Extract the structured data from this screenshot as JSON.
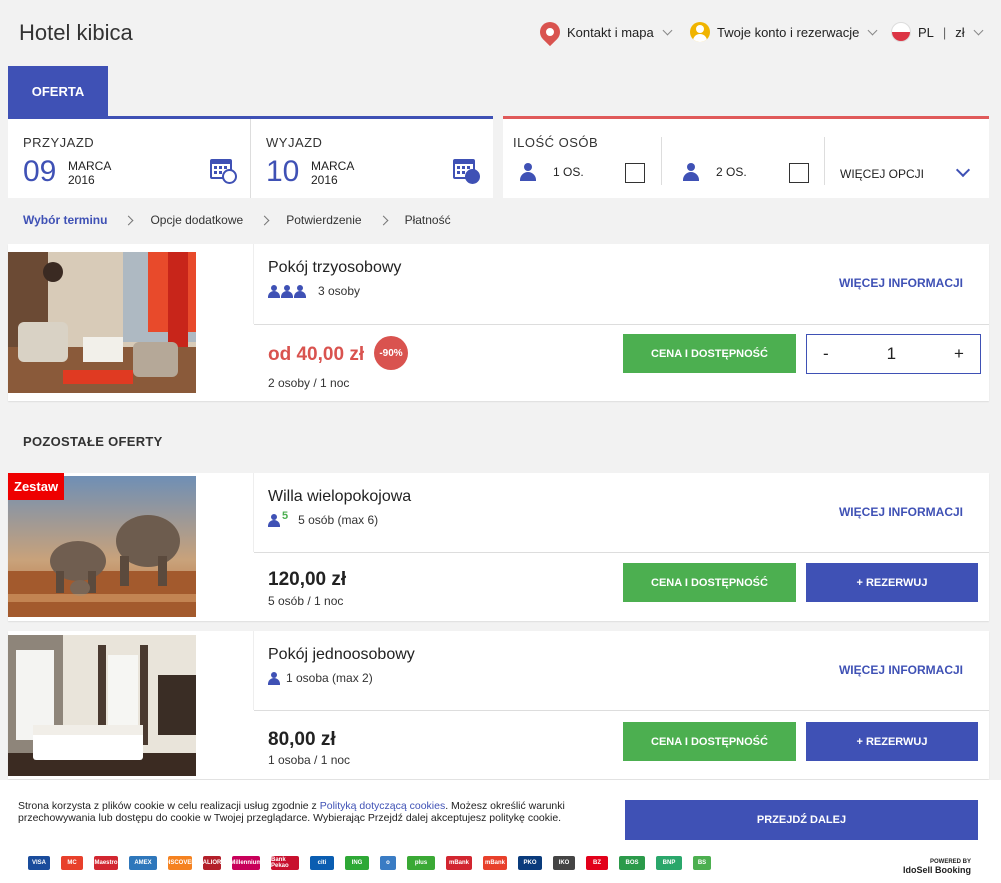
{
  "header": {
    "brand": "Hotel kibica",
    "contact": "Kontakt i mapa",
    "account": "Twoje konto i rezerwacje",
    "lang": "PL",
    "currency": "zł"
  },
  "tabs": {
    "offer": "OFERTA"
  },
  "search": {
    "checkin": {
      "label": "PRZYJAZD",
      "day": "09",
      "month": "MARCA",
      "year": "2016"
    },
    "checkout": {
      "label": "WYJAZD",
      "day": "10",
      "month": "MARCA",
      "year": "2016"
    },
    "persons": {
      "label": "ILOŚĆ OSÓB",
      "opt1": "1 OS.",
      "opt2": "2 OS.",
      "more": "WIĘCEJ OPCJI"
    }
  },
  "breadcrumb": [
    "Wybór terminu",
    "Opcje dodatkowe",
    "Potwierdzenie",
    "Płatność"
  ],
  "rooms": [
    {
      "title": "Pokój trzyosobowy",
      "occupancy": "3 osoby",
      "more_info": "WIĘCEJ INFORMACJI",
      "price": "od 40,00 zł",
      "discount": "-90%",
      "per": "2 osoby / 1 noc",
      "price_btn": "CENA I DOSTĘPNOŚĆ",
      "qty_minus": "-",
      "qty": "1",
      "qty_plus": "+"
    }
  ],
  "other_offers_title": "POZOSTAŁE OFERTY",
  "offers": [
    {
      "badge": "Zestaw",
      "title": "Willa wielopokojowa",
      "occupancy_count": "5",
      "occupancy": "5 osób (max 6)",
      "more_info": "WIĘCEJ INFORMACJI",
      "price": "120,00 zł",
      "per": "5 osób / 1 noc",
      "price_btn": "CENA I DOSTĘPNOŚĆ",
      "book_btn": "+ REZERWUJ"
    },
    {
      "title": "Pokój jednoosobowy",
      "occupancy": "1 osoba (max 2)",
      "more_info": "WIĘCEJ INFORMACJI",
      "price": "80,00 zł",
      "per": "1 osoba / 1 noc",
      "price_btn": "CENA I DOSTĘPNOŚĆ",
      "book_btn": "+ REZERWUJ"
    }
  ],
  "cookie": {
    "text_before": "Strona korzysta z plików cookie w celu realizacji usług zgodnie z ",
    "link": "Polityką dotyczącą cookies",
    "text_after": ". Możesz określić warunki przechowywania lub dostępu do cookie w Twojej przeglądarce. Wybierając Przejdź dalej akceptujesz politykę cookie.",
    "button": "PRZEJDŹ DALEJ"
  },
  "payment_logos": [
    {
      "name": "VISA",
      "color": "#1a4c9c"
    },
    {
      "name": "MC",
      "color": "#e8402b"
    },
    {
      "name": "Maestro",
      "color": "#d22630"
    },
    {
      "name": "AMEX",
      "color": "#2e77bb"
    },
    {
      "name": "DISCOVER",
      "color": "#f58220"
    },
    {
      "name": "ALIOR",
      "color": "#b31f2a"
    },
    {
      "name": "Millennium",
      "color": "#c8005a"
    },
    {
      "name": "Bank Pekao",
      "color": "#c8102e"
    },
    {
      "name": "citi",
      "color": "#0a5db1"
    },
    {
      "name": "ING",
      "color": "#2ea836"
    },
    {
      "name": "o",
      "color": "#3a7cc4"
    },
    {
      "name": "plus",
      "color": "#3aa935"
    },
    {
      "name": "mBank",
      "color": "#d22630"
    },
    {
      "name": "mBank",
      "color": "#e8402b"
    },
    {
      "name": "PKO",
      "color": "#0a3b7c"
    },
    {
      "name": "IKO",
      "color": "#444444"
    },
    {
      "name": "BZ",
      "color": "#e2001a"
    },
    {
      "name": "BOS",
      "color": "#2b9a4a"
    },
    {
      "name": "BNP",
      "color": "#2aa76b"
    },
    {
      "name": "BS",
      "color": "#4caf50"
    }
  ],
  "powered": {
    "line1": "POWERED BY",
    "line2": "IdoSell Booking"
  },
  "colors": {
    "primary": "#3f51b5",
    "green": "#4caf50",
    "red": "#d9534f"
  }
}
